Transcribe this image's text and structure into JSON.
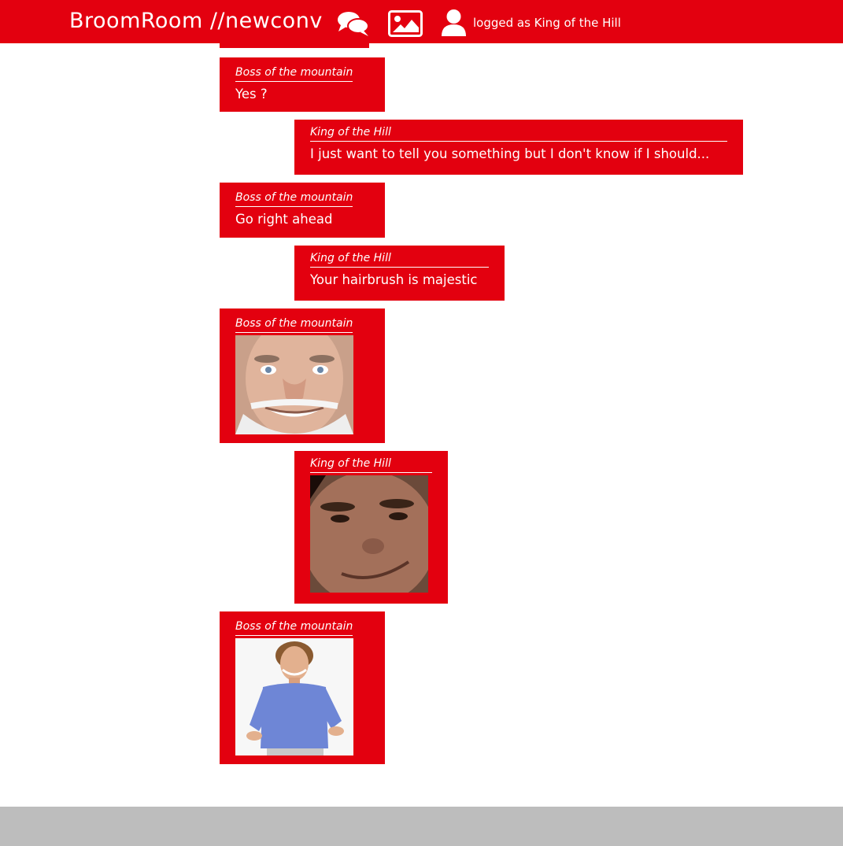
{
  "header": {
    "brand": "BroomRoom //newconv",
    "user_label": "logged as King of the Hill",
    "icons": [
      "chat-icon",
      "image-icon",
      "user-icon"
    ],
    "accent_color": "#e3000f"
  },
  "messages": [
    {
      "author": "Boss of the mountain",
      "text": "Yes ?"
    },
    {
      "author": "King of the Hill",
      "text": "I just want to tell you something but I don't know if I should..."
    },
    {
      "author": "Boss of the mountain",
      "text": "Go right ahead"
    },
    {
      "author": "King of the Hill",
      "text": "Your hairbrush is majestic"
    },
    {
      "author": "Boss of the mountain",
      "image": "smiling-old-man-photo"
    },
    {
      "author": "King of the Hill",
      "image": "smirking-man-photo"
    },
    {
      "author": "Boss of the mountain",
      "image": "man-in-blue-shirt-photo"
    }
  ],
  "footer_color": "#bdbdbd"
}
